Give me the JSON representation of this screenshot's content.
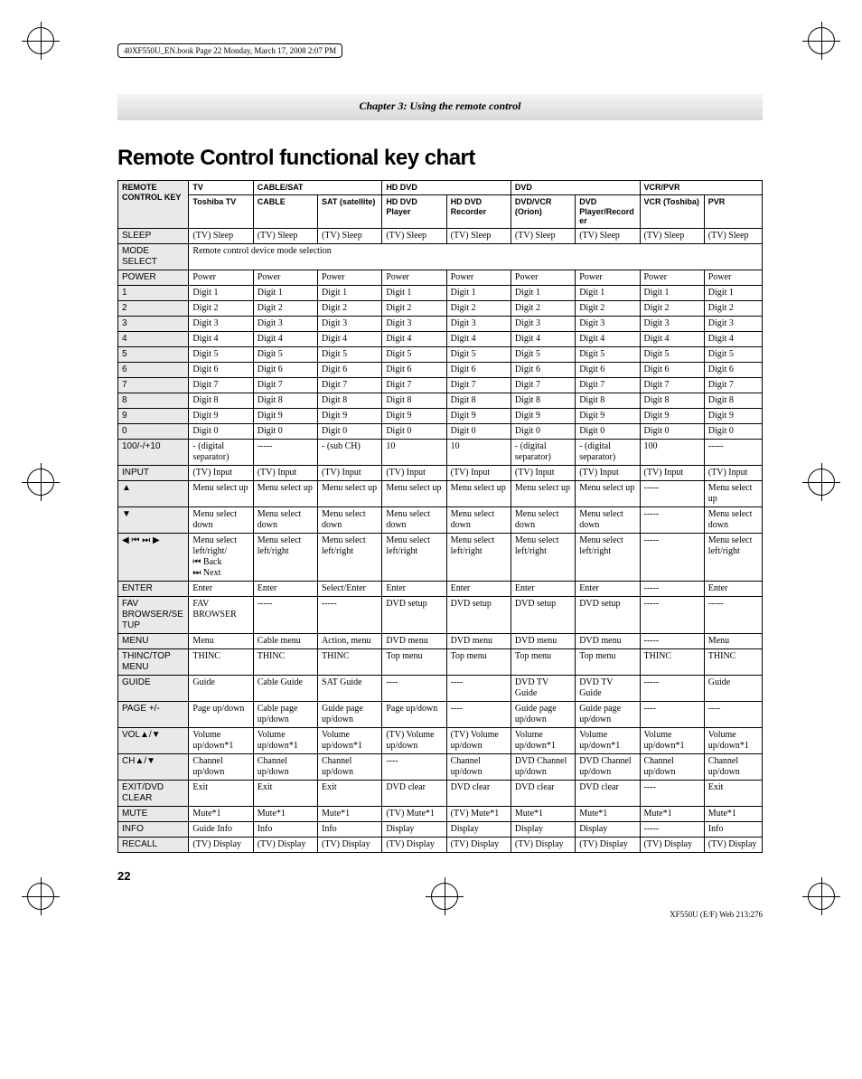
{
  "bookline": "40XF550U_EN.book  Page 22  Monday, March 17, 2008  2:07 PM",
  "chapter": "Chapter 3: Using the remote control",
  "title": "Remote Control functional key chart",
  "pagenum": "22",
  "footer_right": "XF550U (E/F) Web 213:276",
  "key_header": "REMOTE CONTROL KEY",
  "groups": [
    "TV",
    "CABLE/SAT",
    "HD DVD",
    "DVD",
    "VCR/PVR"
  ],
  "subheads": [
    "Toshiba TV",
    "CABLE",
    "SAT (satellite)",
    "HD DVD Player",
    "HD DVD Recorder",
    "DVD/VCR (Orion)",
    "DVD Player/Recorder",
    "VCR (Toshiba)",
    "PVR"
  ],
  "mode_select_row": {
    "key": "MODE SELECT",
    "text": "Remote control device mode selection"
  },
  "arrows_key_cell": {
    "back": " Back",
    "next": " Next"
  },
  "rows": [
    {
      "key": "SLEEP",
      "cells": [
        "(TV) Sleep",
        "(TV) Sleep",
        "(TV) Sleep",
        "(TV) Sleep",
        "(TV) Sleep",
        "(TV) Sleep",
        "(TV) Sleep",
        "(TV) Sleep",
        "(TV) Sleep"
      ]
    },
    {
      "key": "POWER",
      "cells": [
        "Power",
        "Power",
        "Power",
        "Power",
        "Power",
        "Power",
        "Power",
        "Power",
        "Power"
      ]
    },
    {
      "key": "1",
      "cells": [
        "Digit 1",
        "Digit 1",
        "Digit 1",
        "Digit 1",
        "Digit 1",
        "Digit 1",
        "Digit 1",
        "Digit 1",
        "Digit 1"
      ]
    },
    {
      "key": "2",
      "cells": [
        "Digit 2",
        "Digit 2",
        "Digit 2",
        "Digit 2",
        "Digit 2",
        "Digit 2",
        "Digit 2",
        "Digit 2",
        "Digit 2"
      ]
    },
    {
      "key": "3",
      "cells": [
        "Digit 3",
        "Digit 3",
        "Digit 3",
        "Digit 3",
        "Digit 3",
        "Digit 3",
        "Digit 3",
        "Digit 3",
        "Digit 3"
      ]
    },
    {
      "key": "4",
      "cells": [
        "Digit 4",
        "Digit 4",
        "Digit 4",
        "Digit 4",
        "Digit 4",
        "Digit 4",
        "Digit 4",
        "Digit 4",
        "Digit 4"
      ]
    },
    {
      "key": "5",
      "cells": [
        "Digit 5",
        "Digit 5",
        "Digit 5",
        "Digit 5",
        "Digit 5",
        "Digit 5",
        "Digit 5",
        "Digit 5",
        "Digit 5"
      ]
    },
    {
      "key": "6",
      "cells": [
        "Digit 6",
        "Digit 6",
        "Digit 6",
        "Digit 6",
        "Digit 6",
        "Digit 6",
        "Digit 6",
        "Digit 6",
        "Digit 6"
      ]
    },
    {
      "key": "7",
      "cells": [
        "Digit 7",
        "Digit 7",
        "Digit 7",
        "Digit 7",
        "Digit 7",
        "Digit 7",
        "Digit 7",
        "Digit 7",
        "Digit 7"
      ]
    },
    {
      "key": "8",
      "cells": [
        "Digit 8",
        "Digit 8",
        "Digit 8",
        "Digit 8",
        "Digit 8",
        "Digit 8",
        "Digit 8",
        "Digit 8",
        "Digit 8"
      ]
    },
    {
      "key": "9",
      "cells": [
        "Digit 9",
        "Digit 9",
        "Digit 9",
        "Digit 9",
        "Digit 9",
        "Digit 9",
        "Digit 9",
        "Digit 9",
        "Digit 9"
      ]
    },
    {
      "key": "0",
      "cells": [
        "Digit 0",
        "Digit 0",
        "Digit 0",
        "Digit 0",
        "Digit 0",
        "Digit 0",
        "Digit 0",
        "Digit 0",
        "Digit 0"
      ]
    },
    {
      "key": "100/-/+10",
      "cells": [
        "- (digital separator)",
        "-----",
        "- (sub CH)",
        "10",
        "10",
        "- (digital separator)",
        "- (digital separator)",
        "100",
        "-----"
      ]
    },
    {
      "key": "INPUT",
      "cells": [
        "(TV) Input",
        "(TV) Input",
        "(TV) Input",
        "(TV) Input",
        "(TV) Input",
        "(TV) Input",
        "(TV) Input",
        "(TV) Input",
        "(TV) Input"
      ]
    },
    {
      "key": "▲",
      "cells": [
        "Menu select up",
        "Menu select up",
        "Menu select up",
        "Menu select up",
        "Menu select up",
        "Menu select up",
        "Menu select up",
        "-----",
        "Menu select up"
      ]
    },
    {
      "key": "▼",
      "cells": [
        "Menu select down",
        "Menu select down",
        "Menu select down",
        "Menu select down",
        "Menu select down",
        "Menu select down",
        "Menu select down",
        "-----",
        "Menu select down"
      ]
    },
    {
      "key": "◀ ▸ ▸ ▶",
      "cells": [
        "Menu select left/right/",
        "Menu select left/right",
        "Menu select left/right",
        "Menu select left/right",
        "Menu select left/right",
        "Menu select left/right",
        "Menu select left/right",
        "-----",
        "Menu select left/right"
      ]
    },
    {
      "key": "ENTER",
      "cells": [
        "Enter",
        "Enter",
        "Select/Enter",
        "Enter",
        "Enter",
        "Enter",
        "Enter",
        "-----",
        "Enter"
      ]
    },
    {
      "key": "FAV BROWSER/SETUP",
      "cells": [
        "FAV BROWSER",
        "-----",
        "-----",
        "DVD setup",
        "DVD setup",
        "DVD setup",
        "DVD setup",
        "-----",
        "-----"
      ]
    },
    {
      "key": "MENU",
      "cells": [
        "Menu",
        "Cable menu",
        "Action, menu",
        "DVD menu",
        "DVD menu",
        "DVD menu",
        "DVD menu",
        "-----",
        "Menu"
      ]
    },
    {
      "key": "THINC/TOP MENU",
      "cells": [
        "THINC",
        "THINC",
        "THINC",
        "Top menu",
        "Top menu",
        "Top menu",
        "Top menu",
        "THINC",
        "THINC"
      ]
    },
    {
      "key": "GUIDE",
      "cells": [
        "Guide",
        "Cable Guide",
        "SAT Guide",
        "----",
        "----",
        "DVD TV Guide",
        "DVD TV Guide",
        "-----",
        "Guide"
      ]
    },
    {
      "key": "PAGE +/-",
      "cells": [
        "Page up/down",
        "Cable page up/down",
        "Guide page up/down",
        "Page up/down",
        "----",
        "Guide page up/down",
        "Guide page up/down",
        "----",
        "----"
      ]
    },
    {
      "key": "VOL▲/▼",
      "cells": [
        "Volume up/down*1",
        "Volume up/down*1",
        "Volume up/down*1",
        "(TV) Volume up/down",
        "(TV) Volume up/down",
        "Volume up/down*1",
        "Volume up/down*1",
        "Volume up/down*1",
        "Volume up/down*1"
      ]
    },
    {
      "key": "CH▲/▼",
      "cells": [
        "Channel up/down",
        "Channel up/down",
        "Channel up/down",
        "----",
        "Channel up/down",
        "DVD Channel up/down",
        "DVD Channel up/down",
        "Channel up/down",
        "Channel up/down"
      ]
    },
    {
      "key": "EXIT/DVD CLEAR",
      "cells": [
        "Exit",
        "Exit",
        "Exit",
        "DVD clear",
        "DVD clear",
        "DVD clear",
        "DVD clear",
        "----",
        "Exit"
      ]
    },
    {
      "key": "MUTE",
      "cells": [
        "Mute*1",
        "Mute*1",
        "Mute*1",
        "(TV) Mute*1",
        "(TV) Mute*1",
        "Mute*1",
        "Mute*1",
        "Mute*1",
        "Mute*1"
      ]
    },
    {
      "key": "INFO",
      "cells": [
        "Guide Info",
        "Info",
        "Info",
        "Display",
        "Display",
        "Display",
        "Display",
        "-----",
        "Info"
      ]
    },
    {
      "key": "RECALL",
      "cells": [
        "(TV) Display",
        "(TV) Display",
        "(TV) Display",
        "(TV) Display",
        "(TV) Display",
        "(TV) Display",
        "(TV) Display",
        "(TV) Display",
        "(TV) Display"
      ]
    }
  ]
}
